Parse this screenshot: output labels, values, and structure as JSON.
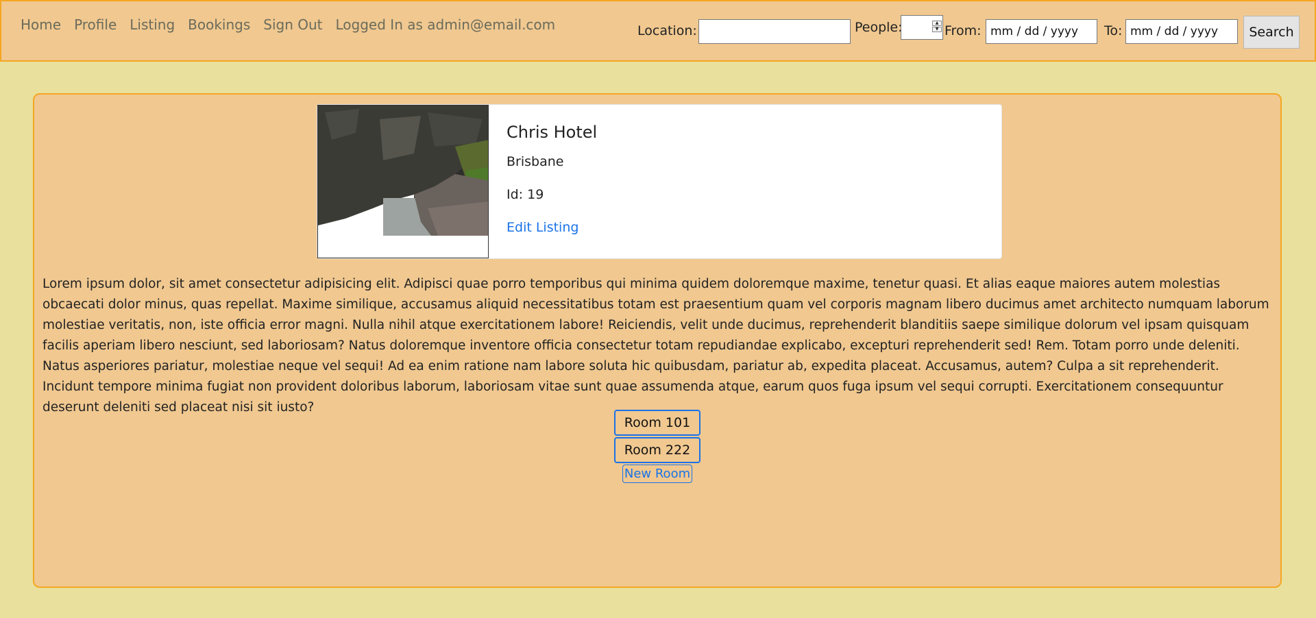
{
  "nav": {
    "items": [
      {
        "label": "Home"
      },
      {
        "label": "Profile"
      },
      {
        "label": "Listing"
      },
      {
        "label": "Bookings"
      },
      {
        "label": "Sign Out"
      }
    ],
    "logged_in": "Logged In as admin@email.com"
  },
  "search": {
    "location_label": "Location:",
    "location_value": "",
    "people_label": "People:",
    "people_value": "",
    "from_label": "From:",
    "from_value": "mm / dd / yyyy",
    "to_label": "To:",
    "to_value": "mm / dd / yyyy",
    "button_label": "Search"
  },
  "listing": {
    "title": "Chris Hotel",
    "location": "Brisbane",
    "id_text": "Id: 19",
    "edit_label": "Edit Listing",
    "description": "Lorem ipsum dolor, sit amet consectetur adipisicing elit. Adipisci quae porro temporibus qui minima quidem doloremque maxime, tenetur quasi. Et alias eaque maiores autem molestias obcaecati dolor minus, quas repellat. Maxime similique, accusamus aliquid necessitatibus totam est praesentium quam vel corporis magnam libero ducimus amet architecto numquam laborum molestiae veritatis, non, iste officia error magni. Nulla nihil atque exercitationem labore! Reiciendis, velit unde ducimus, reprehenderit blanditiis saepe similique dolorum vel ipsam quisquam facilis aperiam libero nesciunt, sed laboriosam? Natus doloremque inventore officia consectetur totam repudiandae explicabo, excepturi reprehenderit sed! Rem. Totam porro unde deleniti. Natus asperiores pariatur, molestiae neque vel sequi! Ad ea enim ratione nam labore soluta hic quibusdam, pariatur ab, expedita placeat. Accusamus, autem? Culpa a sit reprehenderit. Incidunt tempore minima fugiat non provident doloribus laborum, laboriosam vitae sunt quae assumenda atque, earum quos fuga ipsum vel sequi corrupti. Exercitationem consequuntur deserunt deleniti sed placeat nisi sit iusto?"
  },
  "rooms": [
    {
      "label": "Room 101"
    },
    {
      "label": "Room 222"
    }
  ],
  "new_room_label": "New Room",
  "colors": {
    "page_bg": "#e8e09c",
    "bar_bg": "#f0c890",
    "accent_border": "#f5a623",
    "link": "#1a73e8"
  },
  "icons": [
    "spinner-up-icon",
    "spinner-down-icon"
  ]
}
